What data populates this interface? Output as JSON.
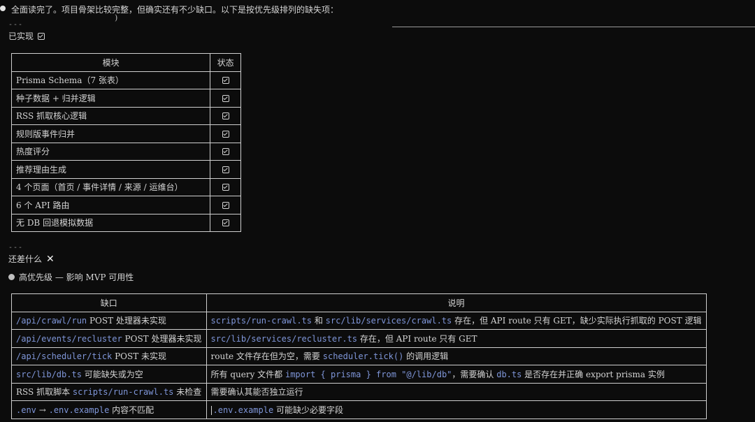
{
  "intro": {
    "text": "全面读完了。项目骨架比较完整，但确实还有不少缺口。以下是按优先级排列的缺失项：",
    "paren": ")"
  },
  "divider": "---",
  "implemented": {
    "title": "已实现",
    "icon": "check-icon",
    "columns": [
      "模块",
      "状态"
    ],
    "rows": [
      {
        "module": "Prisma Schema（7 张表）",
        "status": "check-icon"
      },
      {
        "module": "种子数据 + 归并逻辑",
        "status": "check-icon"
      },
      {
        "module": "RSS 抓取核心逻辑",
        "status": "check-icon"
      },
      {
        "module": "规则版事件归并",
        "status": "check-icon"
      },
      {
        "module": "热度评分",
        "status": "check-icon"
      },
      {
        "module": "推荐理由生成",
        "status": "check-icon"
      },
      {
        "module": "4 个页面（首页 / 事件详情 / 来源 / 运维台）",
        "status": "check-icon"
      },
      {
        "module": "6 个 API 路由",
        "status": "check-icon"
      },
      {
        "module": "无 DB 回退模拟数据",
        "status": "check-icon"
      }
    ]
  },
  "missing": {
    "title": "还差什么",
    "icon": "x-icon",
    "priority": "高优先级 — 影响 MVP 可用性",
    "columns": [
      "缺口",
      "说明"
    ],
    "rows": [
      {
        "gap": [
          {
            "t": "/api/crawl/run",
            "c": "accent"
          },
          {
            "t": " POST 处理器未实现",
            "c": ""
          }
        ],
        "desc": [
          {
            "t": "scripts/run-crawl.ts",
            "c": "accent"
          },
          {
            "t": " 和 ",
            "c": ""
          },
          {
            "t": "src/lib/services/crawl.ts",
            "c": "accent"
          },
          {
            "t": " 存在，但 API route 只有 GET，缺少实际执行抓取的 POST 逻辑",
            "c": ""
          }
        ]
      },
      {
        "gap": [
          {
            "t": "/api/events/recluster",
            "c": "accent"
          },
          {
            "t": " POST 处理器未实现",
            "c": ""
          }
        ],
        "desc": [
          {
            "t": "src/lib/services/recluster.ts",
            "c": "accent"
          },
          {
            "t": " 存在，但 API route 只有 GET",
            "c": ""
          }
        ]
      },
      {
        "gap": [
          {
            "t": "/api/scheduler/tick",
            "c": "accent"
          },
          {
            "t": " POST 未实现",
            "c": ""
          }
        ],
        "desc": [
          {
            "t": "route 文件存在但为空，需要 ",
            "c": ""
          },
          {
            "t": "scheduler.tick()",
            "c": "accent"
          },
          {
            "t": " 的调用逻辑",
            "c": ""
          }
        ]
      },
      {
        "gap": [
          {
            "t": "src/lib/db.ts",
            "c": "accent"
          },
          {
            "t": " 可能缺失或为空",
            "c": ""
          }
        ],
        "desc": [
          {
            "t": "所有 query 文件都 ",
            "c": ""
          },
          {
            "t": "import { prisma } from \"@/lib/db\"",
            "c": "accent"
          },
          {
            "t": "，需要确认 ",
            "c": ""
          },
          {
            "t": "db.ts",
            "c": "accent"
          },
          {
            "t": " 是否存在并正确 export prisma 实例",
            "c": ""
          }
        ]
      },
      {
        "gap": [
          {
            "t": "RSS 抓取脚本 ",
            "c": ""
          },
          {
            "t": "scripts/run-crawl.ts",
            "c": "accent"
          },
          {
            "t": " 未检查",
            "c": ""
          }
        ],
        "desc": [
          {
            "t": "需要确认其能否独立运行",
            "c": ""
          }
        ]
      },
      {
        "gap": [
          {
            "t": ".env",
            "c": "accent"
          },
          {
            "t": " → ",
            "c": ""
          },
          {
            "t": ".env.example",
            "c": "accent"
          },
          {
            "t": " 内容不匹配",
            "c": ""
          }
        ],
        "desc": [
          {
            "t": ".env.example",
            "c": "accent"
          },
          {
            "t": " 可能缺少必要字段",
            "c": ""
          }
        ]
      }
    ]
  }
}
